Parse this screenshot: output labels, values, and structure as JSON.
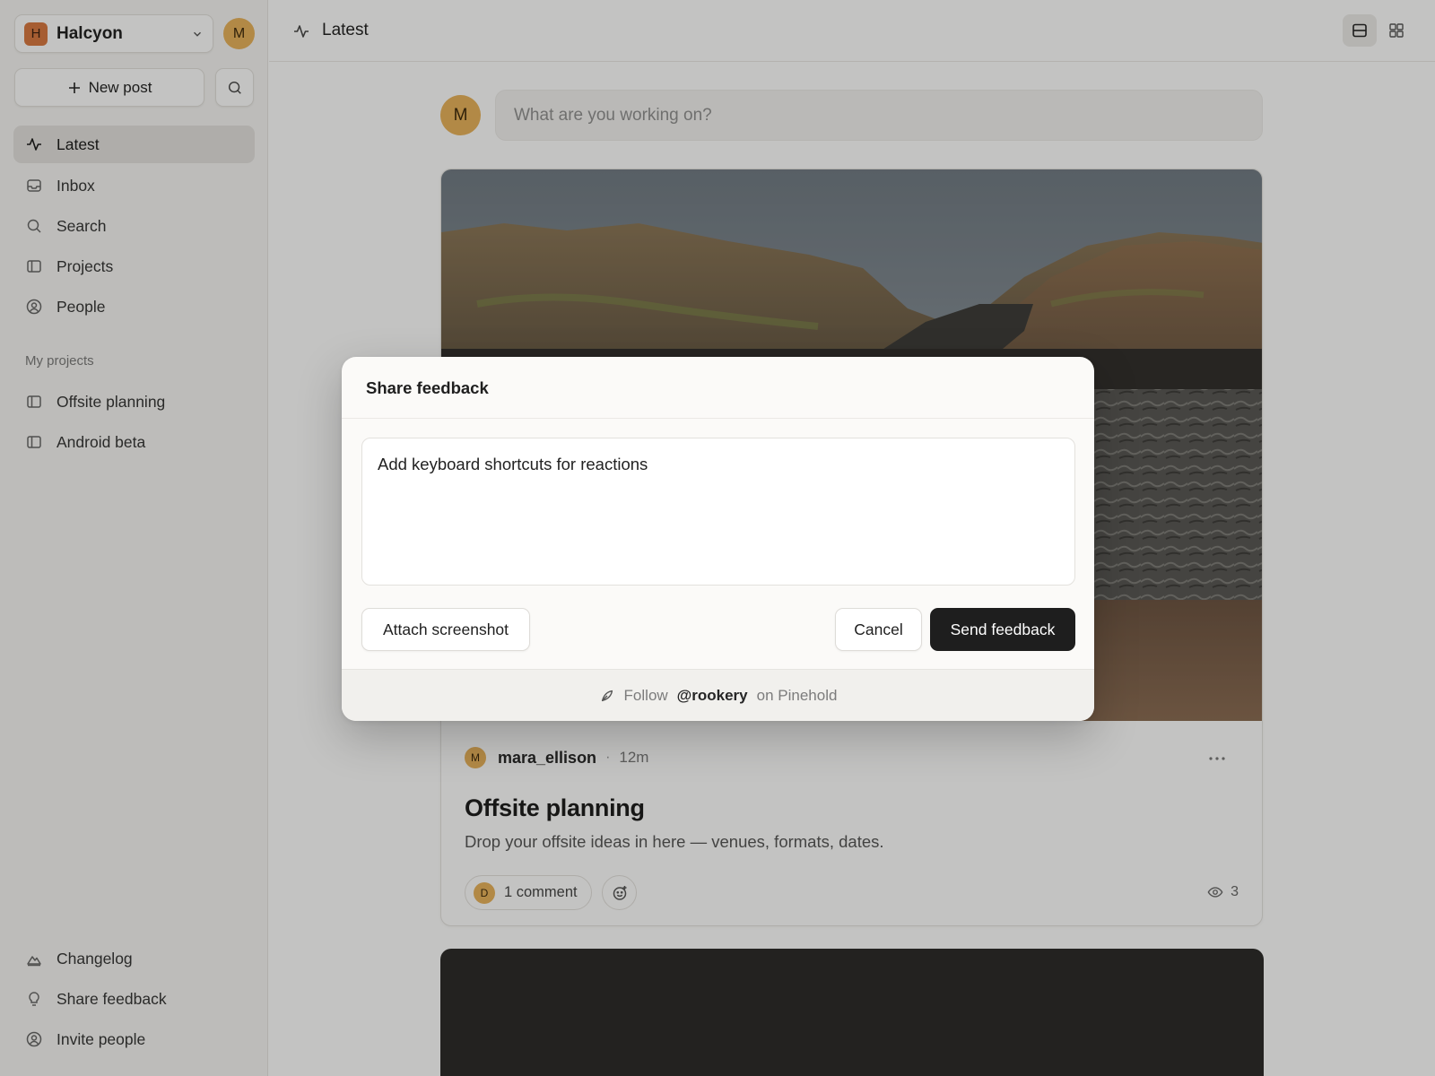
{
  "workspace": {
    "badge": "H",
    "name": "Halcyon",
    "badge_color": "#d9773f"
  },
  "user": {
    "initial": "M",
    "avatar_color": "#e8b25a"
  },
  "sidebar": {
    "new_post_label": "New post",
    "nav": [
      {
        "label": "Latest",
        "icon": "activity-icon",
        "active": true
      },
      {
        "label": "Inbox",
        "icon": "inbox-icon"
      },
      {
        "label": "Search",
        "icon": "search-icon"
      },
      {
        "label": "Projects",
        "icon": "panel-icon"
      },
      {
        "label": "People",
        "icon": "user-circle-icon"
      }
    ],
    "section_label": "My projects",
    "projects": [
      {
        "label": "Offsite planning",
        "icon": "panel-icon"
      },
      {
        "label": "Android beta",
        "icon": "panel-icon"
      }
    ],
    "footer": [
      {
        "label": "Changelog",
        "icon": "mountain-icon"
      },
      {
        "label": "Share feedback",
        "icon": "lightbulb-icon"
      },
      {
        "label": "Invite people",
        "icon": "user-circle-icon"
      }
    ]
  },
  "header": {
    "title": "Latest"
  },
  "composer": {
    "placeholder": "What are you working on?"
  },
  "post": {
    "author_initial": "M",
    "author": "mara_ellison",
    "separator": "·",
    "time": "12m",
    "title": "Offsite planning",
    "body": "Drop your offsite ideas in here — venues, formats, dates.",
    "commenter_initial": "D",
    "comments_label": "1 comment",
    "views": "3"
  },
  "modal": {
    "title": "Share feedback",
    "textarea_value": "Add keyboard shortcuts for reactions",
    "attach_label": "Attach screenshot",
    "cancel_label": "Cancel",
    "send_label": "Send feedback",
    "footer_prefix": "Follow",
    "footer_handle": "@rookery",
    "footer_suffix": "on Pinehold"
  }
}
